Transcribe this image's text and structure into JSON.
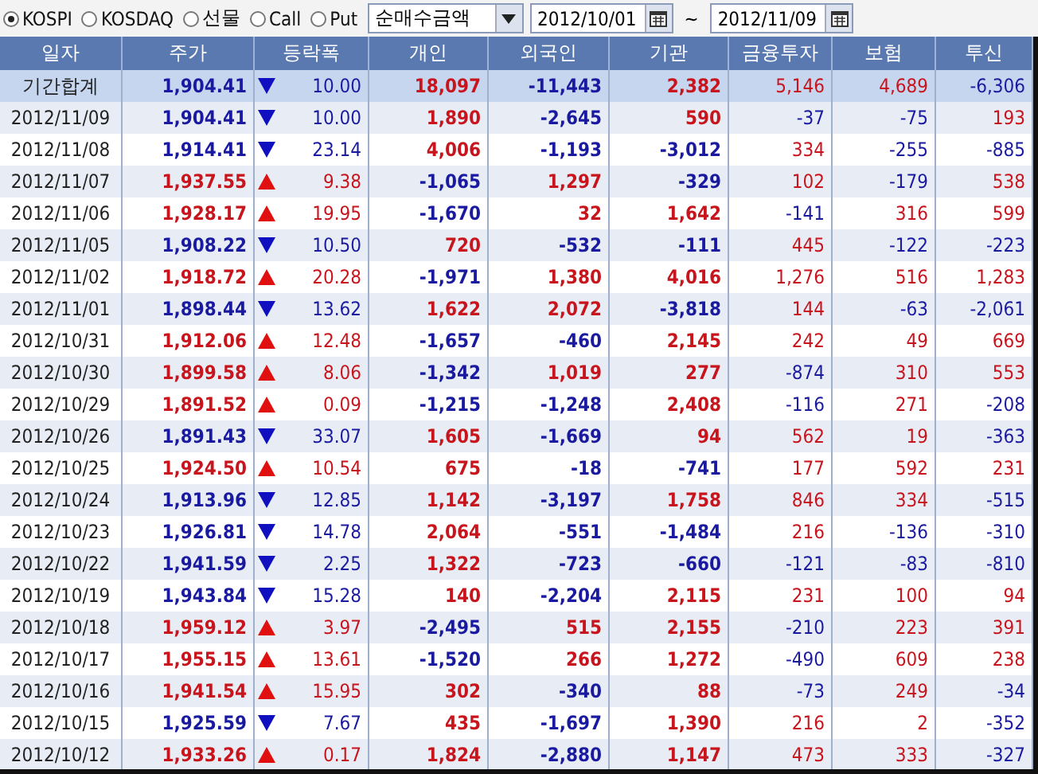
{
  "markets": [
    {
      "label": "KOSPI",
      "selected": true
    },
    {
      "label": "KOSDAQ",
      "selected": false
    },
    {
      "label": "선물",
      "selected": false
    },
    {
      "label": "Call",
      "selected": false
    },
    {
      "label": "Put",
      "selected": false
    }
  ],
  "metric_dropdown": {
    "value": "순매수금액"
  },
  "start_date": {
    "value": "2012/10/01"
  },
  "range_separator": "~",
  "end_date": {
    "value": "2012/11/09"
  },
  "columns": [
    "일자",
    "주가",
    "등락폭",
    "개인",
    "외국인",
    "기관",
    "금융투자",
    "보험",
    "투신"
  ],
  "total": {
    "label": "기간합계",
    "price": "1,904.41",
    "rising": false,
    "change": "10.00",
    "values": [
      "18,097",
      "-11,443",
      "2,382",
      "5,146",
      "4,689",
      "-6,306"
    ]
  },
  "rows": [
    {
      "date": "2012/11/09",
      "price": "1,904.41",
      "rising": false,
      "change": "10.00",
      "values": [
        "1,890",
        "-2,645",
        "590",
        "-37",
        "-75",
        "193"
      ]
    },
    {
      "date": "2012/11/08",
      "price": "1,914.41",
      "rising": false,
      "change": "23.14",
      "values": [
        "4,006",
        "-1,193",
        "-3,012",
        "334",
        "-255",
        "-885"
      ]
    },
    {
      "date": "2012/11/07",
      "price": "1,937.55",
      "rising": true,
      "change": "9.38",
      "values": [
        "-1,065",
        "1,297",
        "-329",
        "102",
        "-179",
        "538"
      ]
    },
    {
      "date": "2012/11/06",
      "price": "1,928.17",
      "rising": true,
      "change": "19.95",
      "values": [
        "-1,670",
        "32",
        "1,642",
        "-141",
        "316",
        "599"
      ]
    },
    {
      "date": "2012/11/05",
      "price": "1,908.22",
      "rising": false,
      "change": "10.50",
      "values": [
        "720",
        "-532",
        "-111",
        "445",
        "-122",
        "-223"
      ]
    },
    {
      "date": "2012/11/02",
      "price": "1,918.72",
      "rising": true,
      "change": "20.28",
      "values": [
        "-1,971",
        "1,380",
        "4,016",
        "1,276",
        "516",
        "1,283"
      ]
    },
    {
      "date": "2012/11/01",
      "price": "1,898.44",
      "rising": false,
      "change": "13.62",
      "values": [
        "1,622",
        "2,072",
        "-3,818",
        "144",
        "-63",
        "-2,061"
      ]
    },
    {
      "date": "2012/10/31",
      "price": "1,912.06",
      "rising": true,
      "change": "12.48",
      "values": [
        "-1,657",
        "-460",
        "2,145",
        "242",
        "49",
        "669"
      ]
    },
    {
      "date": "2012/10/30",
      "price": "1,899.58",
      "rising": true,
      "change": "8.06",
      "values": [
        "-1,342",
        "1,019",
        "277",
        "-874",
        "310",
        "553"
      ]
    },
    {
      "date": "2012/10/29",
      "price": "1,891.52",
      "rising": true,
      "change": "0.09",
      "values": [
        "-1,215",
        "-1,248",
        "2,408",
        "-116",
        "271",
        "-208"
      ]
    },
    {
      "date": "2012/10/26",
      "price": "1,891.43",
      "rising": false,
      "change": "33.07",
      "values": [
        "1,605",
        "-1,669",
        "94",
        "562",
        "19",
        "-363"
      ]
    },
    {
      "date": "2012/10/25",
      "price": "1,924.50",
      "rising": true,
      "change": "10.54",
      "values": [
        "675",
        "-18",
        "-741",
        "177",
        "592",
        "231"
      ]
    },
    {
      "date": "2012/10/24",
      "price": "1,913.96",
      "rising": false,
      "change": "12.85",
      "values": [
        "1,142",
        "-3,197",
        "1,758",
        "846",
        "334",
        "-515"
      ]
    },
    {
      "date": "2012/10/23",
      "price": "1,926.81",
      "rising": false,
      "change": "14.78",
      "values": [
        "2,064",
        "-551",
        "-1,484",
        "216",
        "-136",
        "-310"
      ]
    },
    {
      "date": "2012/10/22",
      "price": "1,941.59",
      "rising": false,
      "change": "2.25",
      "values": [
        "1,322",
        "-723",
        "-660",
        "-121",
        "-83",
        "-810"
      ]
    },
    {
      "date": "2012/10/19",
      "price": "1,943.84",
      "rising": false,
      "change": "15.28",
      "values": [
        "140",
        "-2,204",
        "2,115",
        "231",
        "100",
        "94"
      ]
    },
    {
      "date": "2012/10/18",
      "price": "1,959.12",
      "rising": true,
      "change": "3.97",
      "values": [
        "-2,495",
        "515",
        "2,155",
        "-210",
        "223",
        "391"
      ]
    },
    {
      "date": "2012/10/17",
      "price": "1,955.15",
      "rising": true,
      "change": "13.61",
      "values": [
        "-1,520",
        "266",
        "1,272",
        "-490",
        "609",
        "238"
      ]
    },
    {
      "date": "2012/10/16",
      "price": "1,941.54",
      "rising": true,
      "change": "15.95",
      "values": [
        "302",
        "-340",
        "88",
        "-73",
        "249",
        "-34"
      ]
    },
    {
      "date": "2012/10/15",
      "price": "1,925.59",
      "rising": false,
      "change": "7.67",
      "values": [
        "435",
        "-1,697",
        "1,390",
        "216",
        "2",
        "-352"
      ]
    },
    {
      "date": "2012/10/12",
      "price": "1,933.26",
      "rising": true,
      "change": "0.17",
      "values": [
        "1,824",
        "-2,880",
        "1,147",
        "473",
        "333",
        "-327"
      ]
    }
  ]
}
